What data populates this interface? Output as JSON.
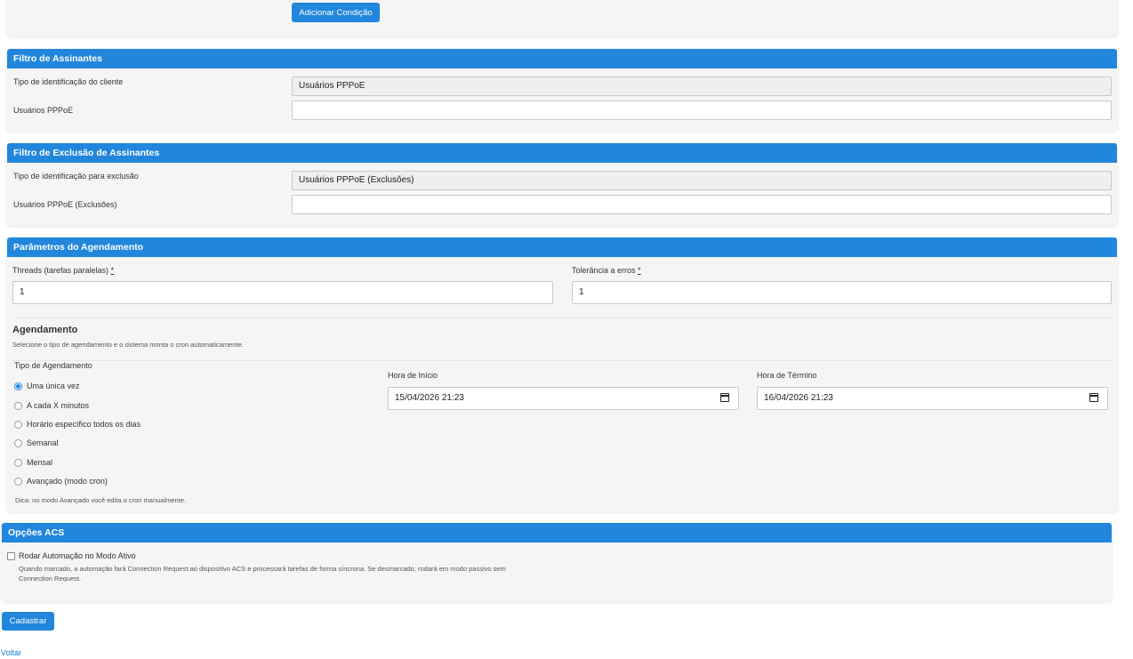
{
  "top": {
    "add_condition_label": "Adicionar Condição"
  },
  "subscriber_filter": {
    "title": "Filtro de Assinantes",
    "id_type_label": "Tipo de identificação do cliente",
    "id_type_value": "Usuários PPPoE",
    "users_label": "Usuários PPPoE",
    "users_value": ""
  },
  "exclusion_filter": {
    "title": "Filtro de Exclusão de Assinantes",
    "id_type_label": "Tipo de identificação para exclusão",
    "id_type_value": "Usuários PPPoE (Exclusões)",
    "users_label": "Usuários PPPoE (Exclusões)",
    "users_value": ""
  },
  "schedule_params": {
    "title": "Parâmetros do Agendamento",
    "threads_label": "Threads (tarefas paralelas)",
    "threads_value": "1",
    "tolerance_label": "Tolerância a erros",
    "tolerance_value": "1",
    "required_mark": "*",
    "scheduling_title": "Agendamento",
    "scheduling_desc": "Selecione o tipo de agendamento e o sistema monta o cron automaticamente.",
    "type_label": "Tipo de Agendamento",
    "options": [
      {
        "label": "Uma única vez",
        "checked": true
      },
      {
        "label": "A cada X minutos",
        "checked": false
      },
      {
        "label": "Horário específico todos os dias",
        "checked": false
      },
      {
        "label": "Semanal",
        "checked": false
      },
      {
        "label": "Mensal",
        "checked": false
      },
      {
        "label": "Avançado (modo cron)",
        "checked": false
      }
    ],
    "hint": "Dica: no modo Avançado você edita o cron manualmente.",
    "start_label": "Hora de Início",
    "start_value": "15/04/2026 21:23",
    "end_label": "Hora de Término",
    "end_value": "16/04/2026 21:23"
  },
  "acs_options": {
    "title": "Opções ACS",
    "active_mode_label": "Rodar Automação no Modo Ativo",
    "active_mode_checked": false,
    "active_mode_desc": "Quando marcado, a automação fará Connection Request ao dispositivo ACS e processará tarefas de forma síncrona. Se desmarcado, rodará em modo passivo sem Connection Request."
  },
  "footer": {
    "submit_label": "Cadastrar",
    "back_label": "Voltar"
  },
  "colors": {
    "accent": "#2186dc",
    "card_bg": "#f5f5f5"
  }
}
